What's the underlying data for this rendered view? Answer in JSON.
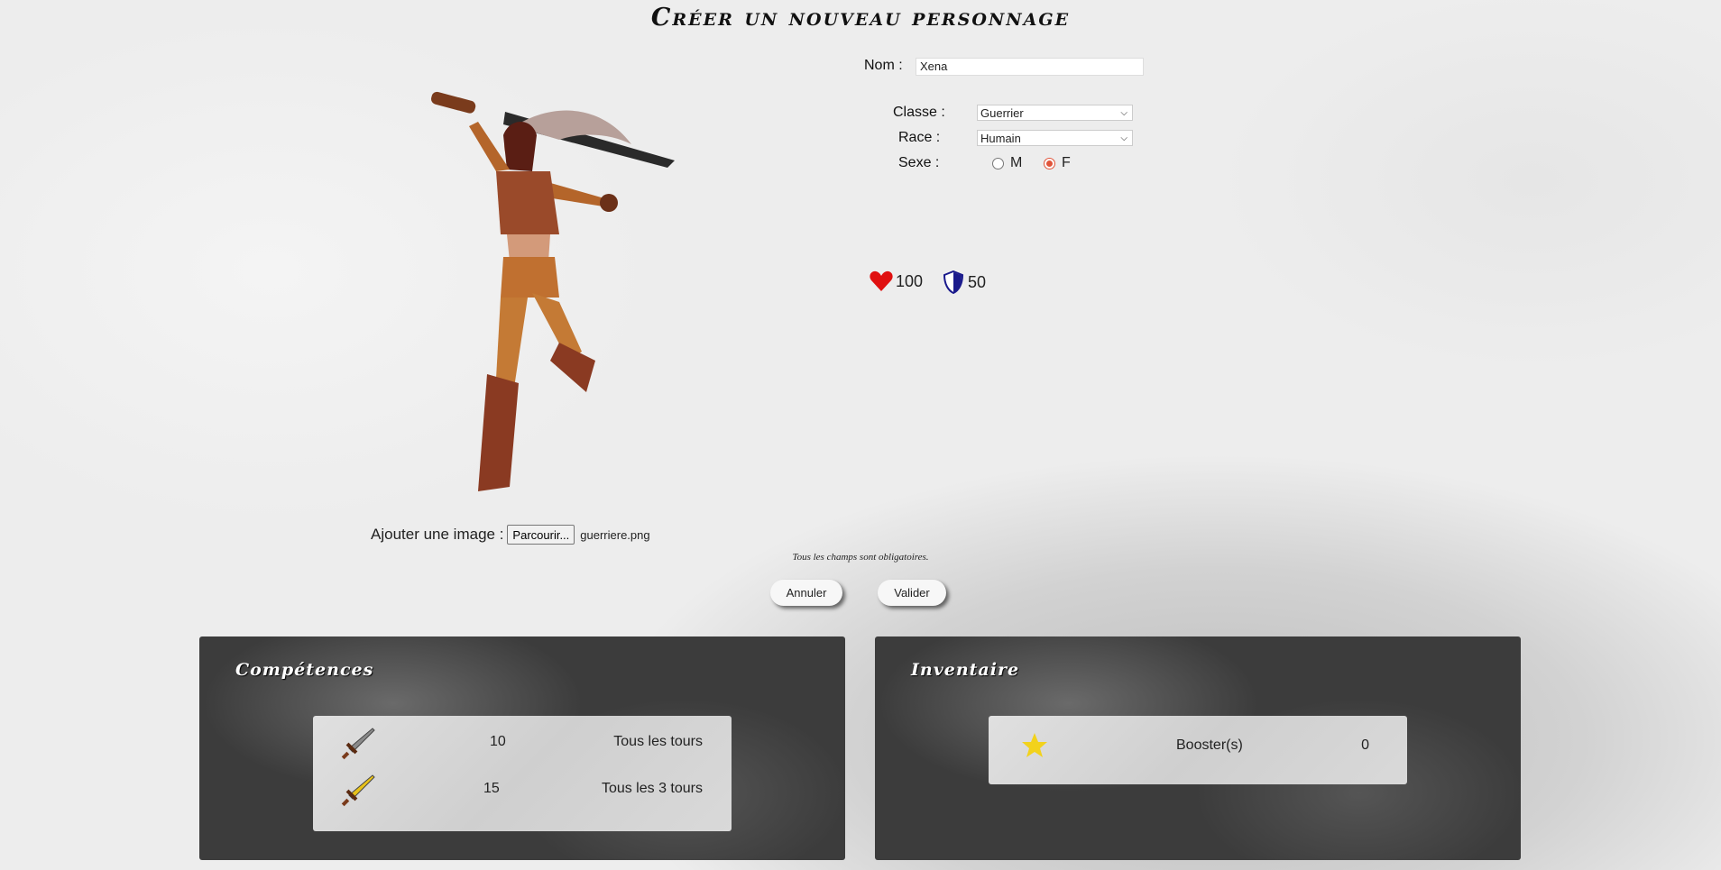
{
  "page": {
    "title": "Créer un nouveau personnage",
    "required_note": "Tous les champs sont obligatoires."
  },
  "form": {
    "name_label": "Nom :",
    "name_value": "Xena",
    "class_label": "Classe :",
    "class_value": "Guerrier",
    "race_label": "Race :",
    "race_value": "Humain",
    "sex_label": "Sexe :",
    "sex_options": [
      "M",
      "F"
    ],
    "sex_selected": "F",
    "add_image_label": "Ajouter une image :",
    "browse_label": "Parcourir...",
    "file_name": "guerriere.png"
  },
  "stats": {
    "health": "100",
    "armor": "50",
    "health_color": "#e01010",
    "armor_color": "#1a1a8c"
  },
  "actions": {
    "cancel": "Annuler",
    "submit": "Valider"
  },
  "skills": {
    "title": "Compétences",
    "items": [
      {
        "icon": "sword-icon",
        "value": "10",
        "frequency": "Tous les tours"
      },
      {
        "icon": "golden-sword-icon",
        "value": "15",
        "frequency": "Tous les 3 tours"
      }
    ]
  },
  "inventory": {
    "title": "Inventaire",
    "items": [
      {
        "icon": "star-icon",
        "name": "Booster(s)",
        "count": "0"
      }
    ]
  }
}
